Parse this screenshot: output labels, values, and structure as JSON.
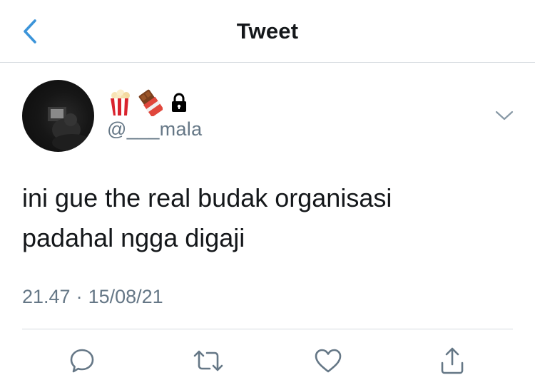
{
  "header": {
    "title": "Tweet",
    "back_icon": "chevron-left-icon",
    "accent_color": "#3b94d9"
  },
  "author": {
    "display_emojis": [
      "popcorn-emoji",
      "chocolate-bar-emoji",
      "lock-icon"
    ],
    "handle": "@___mala"
  },
  "tweet": {
    "lines": [
      "ini gue the real budak organisasi",
      "padahal ngga digaji"
    ],
    "time": "21.47",
    "separator": "·",
    "date": "15/08/21"
  },
  "actions": [
    {
      "name": "reply",
      "icon": "reply-icon"
    },
    {
      "name": "retweet",
      "icon": "retweet-icon"
    },
    {
      "name": "like",
      "icon": "heart-icon"
    },
    {
      "name": "share",
      "icon": "share-icon"
    }
  ],
  "colors": {
    "text_primary": "#14171a",
    "text_secondary": "#657786",
    "divider": "#d6dbe0",
    "icon": "#657786"
  }
}
